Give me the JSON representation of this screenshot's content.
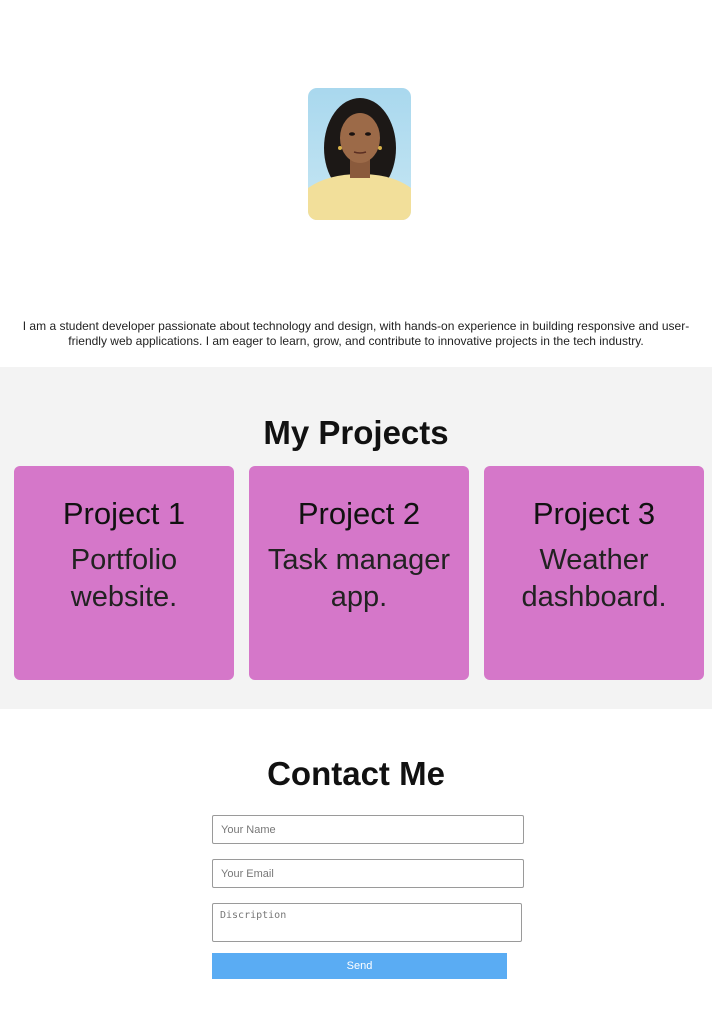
{
  "profile": {
    "bio": "I am a student developer passionate about technology and design, with hands-on experience in building responsive and user-friendly web applications. I am eager to learn, grow, and contribute to innovative projects in the tech industry."
  },
  "projects": {
    "title": "My Projects",
    "items": [
      {
        "title": "Project 1",
        "description": "Portfolio website."
      },
      {
        "title": "Project 2",
        "description": "Task manager app."
      },
      {
        "title": "Project 3",
        "description": "Weather dashboard."
      }
    ]
  },
  "contact": {
    "title": "Contact Me",
    "name_placeholder": "Your Name",
    "email_placeholder": "Your Email",
    "description_placeholder": "Discription",
    "send_label": "Send"
  },
  "colors": {
    "card": "#d577c9",
    "section_bg": "#f3f3f3",
    "button": "#5aacf3"
  }
}
